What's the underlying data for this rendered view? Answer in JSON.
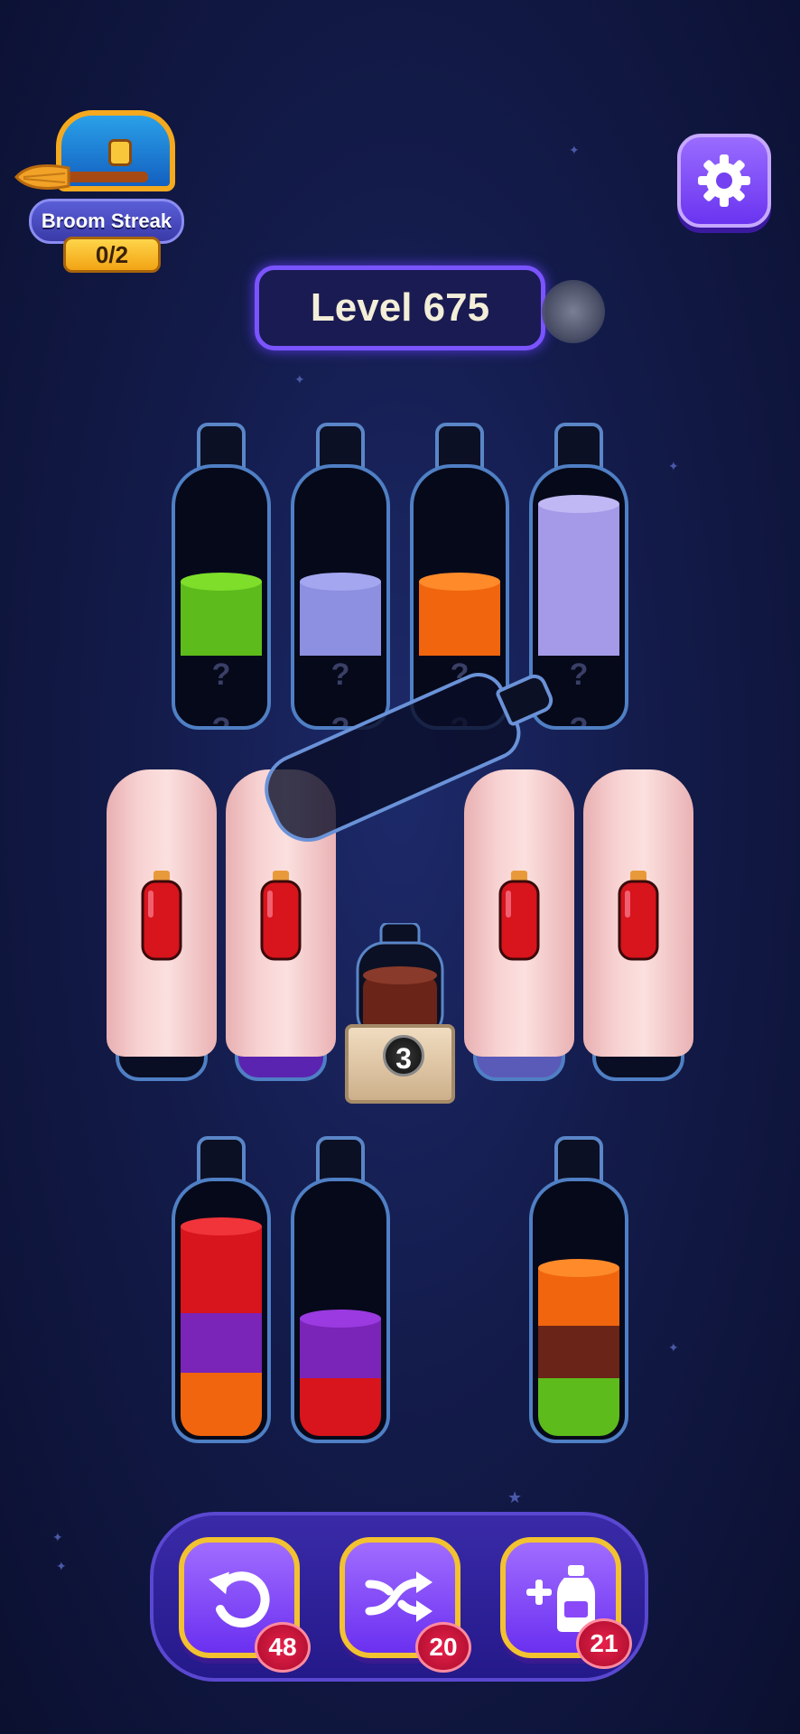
{
  "streak": {
    "label": "Broom Streak",
    "count": "0/2"
  },
  "settings": {
    "icon": "gear-icon"
  },
  "level": {
    "label": "Level 675"
  },
  "colors": {
    "green": "#5dbb1c",
    "lavender": "#8d8fe0",
    "orange": "#f0650e",
    "red": "#d8141c",
    "purple": "#7a24b8",
    "brown": "#6a2418",
    "lightlavender": "#a49ae8"
  },
  "top_bottles": [
    {
      "layers": [
        "green"
      ],
      "hidden": 2
    },
    {
      "layers": [
        "lavender"
      ],
      "hidden": 2
    },
    {
      "layers": [
        "orange"
      ],
      "hidden": 2
    },
    {
      "layers": [
        "lightlavender"
      ],
      "hidden": 2
    }
  ],
  "locked_bottle": {
    "color": "brown",
    "unlock_count": "3"
  },
  "bottom_bottles": [
    {
      "layers": [
        "red",
        "red",
        "purple",
        "orange"
      ]
    },
    {
      "layers": [
        "purple",
        "red"
      ]
    },
    {
      "layers": [
        "orange",
        "brown",
        "green"
      ]
    }
  ],
  "toolbar": {
    "undo": {
      "icon": "undo-icon",
      "count": "48"
    },
    "shuffle": {
      "icon": "shuffle-icon",
      "count": "20"
    },
    "add_bottle": {
      "icon": "add-bottle-icon",
      "count": "21"
    }
  }
}
